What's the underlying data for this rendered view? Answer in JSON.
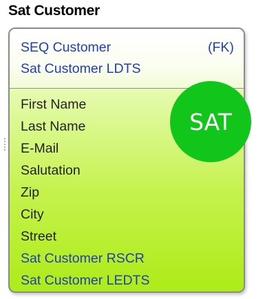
{
  "entity": {
    "title": "Sat Customer",
    "key_fields": [
      {
        "name": "SEQ Customer",
        "tag": "(FK)"
      },
      {
        "name": "Sat Customer LDTS",
        "tag": ""
      }
    ],
    "attributes": [
      "First Name",
      "Last Name",
      "E-Mail",
      "Salutation",
      "Zip",
      "City",
      "Street",
      "Sat Customer  RSCR",
      "Sat Customer  LEDTS"
    ]
  },
  "badge": {
    "label": "SAT",
    "color": "#11c51b"
  },
  "colors": {
    "key_text": "#1f3fb0",
    "attribute_text": "#222222",
    "box_gradient_bottom": "#adeb18",
    "border": "#8a8a8a"
  }
}
